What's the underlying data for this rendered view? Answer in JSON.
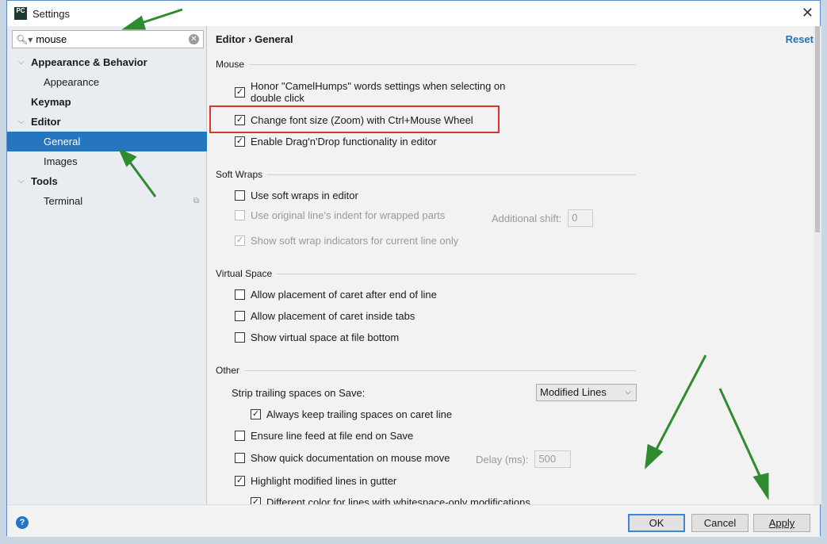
{
  "window": {
    "title": "Settings",
    "logo": "PC"
  },
  "search": {
    "value": "mouse"
  },
  "tree": [
    {
      "label": "Appearance & Behavior",
      "bold": true,
      "expanded": true
    },
    {
      "label": "Appearance",
      "bold": false
    },
    {
      "label": "Keymap",
      "bold": true
    },
    {
      "label": "Editor",
      "bold": true,
      "expanded": true
    },
    {
      "label": "General",
      "bold": false,
      "selected": true
    },
    {
      "label": "Images",
      "bold": false
    },
    {
      "label": "Tools",
      "bold": true,
      "expanded": true
    },
    {
      "label": "Terminal",
      "bold": false
    }
  ],
  "breadcrumb": {
    "parent": "Editor",
    "sep": "›",
    "current": "General"
  },
  "reset_label": "Reset",
  "sections": {
    "mouse": "Mouse",
    "soft_wraps": "Soft Wraps",
    "virtual_space": "Virtual Space",
    "other": "Other"
  },
  "options": {
    "camel1": "Honor \"CamelHumps\" words settings when selecting on",
    "camel2": "double click",
    "zoom": "Change font size (Zoom) with Ctrl+Mouse Wheel",
    "dnd": "Enable Drag'n'Drop functionality in editor",
    "softwrap": "Use soft wraps in editor",
    "indent": "Use original line's indent for wrapped parts",
    "additional_shift_label": "Additional shift:",
    "additional_shift_value": "0",
    "indicators": "Show soft wrap indicators for current line only",
    "caret_end": "Allow placement of caret after end of line",
    "caret_tabs": "Allow placement of caret inside tabs",
    "vspace": "Show virtual space at file bottom",
    "strip_label": "Strip trailing spaces on Save:",
    "strip_value": "Modified Lines",
    "keep_trailing": "Always keep trailing spaces on caret line",
    "line_feed": "Ensure line feed at file end on Save",
    "quick_doc": "Show quick documentation on mouse move",
    "delay_label": "Delay (ms):",
    "delay_value": "500",
    "highlight": "Highlight modified lines in gutter",
    "diff_color": "Different color for lines with whitespace-only modifications"
  },
  "buttons": {
    "ok": "OK",
    "cancel": "Cancel",
    "apply": "Apply",
    "help": "?"
  },
  "colors": {
    "selection": "#2675bf",
    "highlight_box": "#e03030",
    "annotation_arrow": "#2e8b2e",
    "link": "#2470b3"
  }
}
